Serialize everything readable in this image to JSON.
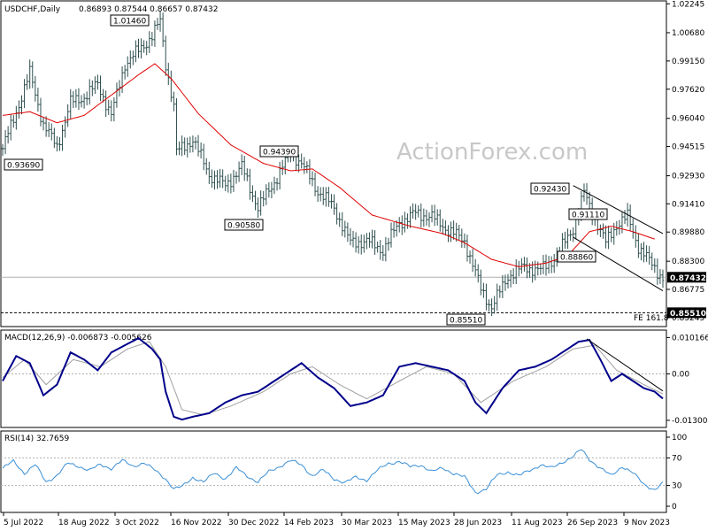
{
  "header": {
    "symbol": "USDCHF,Daily",
    "ohlc": "0.86893 0.87544 0.86657 0.87432"
  },
  "watermark": "ActionForex.com",
  "colors": {
    "bars": "#2f4f4f",
    "ma": "#e00000",
    "macd": "#00008b",
    "signal": "#a0a0a0",
    "rsi": "#3a8fd6",
    "trendline": "#000000"
  },
  "chart_data": [
    {
      "type": "line",
      "title": "USDCHF,Daily",
      "price_axis_labels": [
        "1.02245",
        "1.00680",
        "0.99150",
        "0.97620",
        "0.96040",
        "0.94515",
        "0.92930",
        "0.91410",
        "0.89880",
        "0.88300",
        "0.86775",
        "0.85245"
      ],
      "ylim": [
        0.85,
        1.0226
      ],
      "current_price_label": "0.87432",
      "support_label": "0.85510",
      "fe_label": "FE 161.8",
      "swing_labels": [
        {
          "text": "1.01460",
          "value": 1.0146
        },
        {
          "text": "0.93690",
          "value": 0.9369
        },
        {
          "text": "0.94390",
          "value": 0.9439
        },
        {
          "text": "0.90580",
          "value": 0.9058
        },
        {
          "text": "0.92430",
          "value": 0.9243
        },
        {
          "text": "0.91110",
          "value": 0.9111
        },
        {
          "text": "0.88860",
          "value": 0.8886
        },
        {
          "text": "0.85510",
          "value": 0.8551
        }
      ],
      "date_labels": [
        "5 Jul 2022",
        "18 Aug 2022",
        "3 Oct 2022",
        "16 Nov 2022",
        "30 Dec 2022",
        "14 Feb 2023",
        "30 Mar 2023",
        "15 May 2023",
        "28 Jun 2023",
        "11 Aug 2023",
        "26 Sep 2023",
        "9 Nov 2023"
      ],
      "close_path": [
        [
          0,
          0.944
        ],
        [
          6,
          0.968
        ],
        [
          10,
          0.985
        ],
        [
          15,
          0.957
        ],
        [
          20,
          0.945
        ],
        [
          25,
          0.969
        ],
        [
          30,
          0.972
        ],
        [
          35,
          0.979
        ],
        [
          40,
          0.962
        ],
        [
          45,
          0.99
        ],
        [
          50,
          0.997
        ],
        [
          55,
          1.005
        ],
        [
          58,
          1.013
        ],
        [
          60,
          0.99
        ],
        [
          63,
          0.967
        ],
        [
          64,
          0.942
        ],
        [
          70,
          0.949
        ],
        [
          76,
          0.93
        ],
        [
          82,
          0.924
        ],
        [
          88,
          0.934
        ],
        [
          94,
          0.912
        ],
        [
          100,
          0.926
        ],
        [
          106,
          0.942
        ],
        [
          110,
          0.936
        ],
        [
          116,
          0.921
        ],
        [
          122,
          0.912
        ],
        [
          128,
          0.893
        ],
        [
          134,
          0.894
        ],
        [
          140,
          0.889
        ],
        [
          146,
          0.904
        ],
        [
          152,
          0.909
        ],
        [
          158,
          0.907
        ],
        [
          164,
          0.9
        ],
        [
          170,
          0.894
        ],
        [
          176,
          0.868
        ],
        [
          180,
          0.858
        ],
        [
          186,
          0.875
        ],
        [
          192,
          0.88
        ],
        [
          198,
          0.878
        ],
        [
          204,
          0.886
        ],
        [
          210,
          0.901
        ],
        [
          214,
          0.92
        ],
        [
          218,
          0.906
        ],
        [
          222,
          0.893
        ],
        [
          226,
          0.903
        ],
        [
          230,
          0.907
        ],
        [
          234,
          0.891
        ],
        [
          238,
          0.883
        ],
        [
          243,
          0.874
        ]
      ],
      "ma_path": [
        [
          0,
          0.962
        ],
        [
          10,
          0.964
        ],
        [
          20,
          0.958
        ],
        [
          30,
          0.962
        ],
        [
          40,
          0.973
        ],
        [
          50,
          0.984
        ],
        [
          56,
          0.99
        ],
        [
          62,
          0.982
        ],
        [
          72,
          0.963
        ],
        [
          84,
          0.946
        ],
        [
          96,
          0.936
        ],
        [
          106,
          0.932
        ],
        [
          114,
          0.933
        ],
        [
          124,
          0.923
        ],
        [
          136,
          0.908
        ],
        [
          150,
          0.902
        ],
        [
          162,
          0.898
        ],
        [
          170,
          0.893
        ],
        [
          180,
          0.884
        ],
        [
          190,
          0.88
        ],
        [
          200,
          0.882
        ],
        [
          208,
          0.886
        ],
        [
          216,
          0.899
        ],
        [
          224,
          0.902
        ],
        [
          232,
          0.899
        ],
        [
          240,
          0.895
        ]
      ],
      "trend_channel": [
        {
          "from": [
            210,
            0.924
          ],
          "to": [
            243,
            0.898
          ]
        },
        {
          "from": [
            210,
            0.896
          ],
          "to": [
            243,
            0.867
          ]
        }
      ]
    },
    {
      "type": "line",
      "title": "MACD(12,26,9) -0.006873 -0.005626",
      "axis_labels": [
        "0.010166",
        "0.00",
        "-0.013006"
      ],
      "ylim": [
        -0.0145,
        0.0115
      ],
      "macd_path": [
        [
          0,
          -0.002
        ],
        [
          5,
          0.005
        ],
        [
          10,
          0.003
        ],
        [
          15,
          -0.006
        ],
        [
          20,
          -0.003
        ],
        [
          25,
          0.006
        ],
        [
          30,
          0.004
        ],
        [
          35,
          0.001
        ],
        [
          40,
          0.006
        ],
        [
          45,
          0.008
        ],
        [
          50,
          0.01
        ],
        [
          55,
          0.007
        ],
        [
          58,
          0.004
        ],
        [
          60,
          -0.005
        ],
        [
          63,
          -0.012
        ],
        [
          66,
          -0.0128
        ],
        [
          70,
          -0.012
        ],
        [
          76,
          -0.011
        ],
        [
          82,
          -0.008
        ],
        [
          88,
          -0.006
        ],
        [
          94,
          -0.005
        ],
        [
          100,
          -0.002
        ],
        [
          106,
          0.001
        ],
        [
          110,
          0.003
        ],
        [
          116,
          -0.001
        ],
        [
          122,
          -0.004
        ],
        [
          128,
          -0.009
        ],
        [
          134,
          -0.008
        ],
        [
          140,
          -0.006
        ],
        [
          146,
          0.002
        ],
        [
          152,
          0.003
        ],
        [
          158,
          0.002
        ],
        [
          164,
          0.001
        ],
        [
          170,
          -0.002
        ],
        [
          174,
          -0.008
        ],
        [
          178,
          -0.011
        ],
        [
          184,
          -0.004
        ],
        [
          190,
          0.001
        ],
        [
          196,
          0.002
        ],
        [
          202,
          0.004
        ],
        [
          208,
          0.007
        ],
        [
          212,
          0.009
        ],
        [
          216,
          0.0095
        ],
        [
          220,
          0.004
        ],
        [
          224,
          -0.002
        ],
        [
          228,
          0.0
        ],
        [
          232,
          -0.002
        ],
        [
          236,
          -0.004
        ],
        [
          240,
          -0.005
        ],
        [
          243,
          -0.0069
        ]
      ],
      "signal_path": [
        [
          0,
          -0.001
        ],
        [
          8,
          0.004
        ],
        [
          16,
          -0.003
        ],
        [
          26,
          0.004
        ],
        [
          36,
          0.002
        ],
        [
          46,
          0.007
        ],
        [
          54,
          0.009
        ],
        [
          60,
          0.002
        ],
        [
          66,
          -0.01
        ],
        [
          74,
          -0.0115
        ],
        [
          84,
          -0.009
        ],
        [
          96,
          -0.005
        ],
        [
          106,
          0.0
        ],
        [
          114,
          0.002
        ],
        [
          124,
          -0.003
        ],
        [
          134,
          -0.007
        ],
        [
          146,
          -0.002
        ],
        [
          156,
          0.002
        ],
        [
          166,
          0.0
        ],
        [
          176,
          -0.008
        ],
        [
          188,
          -0.002
        ],
        [
          200,
          0.002
        ],
        [
          210,
          0.007
        ],
        [
          218,
          0.008
        ],
        [
          226,
          0.001
        ],
        [
          236,
          -0.003
        ],
        [
          243,
          -0.0056
        ]
      ],
      "trendline": {
        "from": [
          215,
          0.0098
        ],
        "to": [
          243,
          -0.0048
        ]
      }
    },
    {
      "type": "line",
      "title": "RSI(14) 32.7659",
      "axis_labels": [
        "100",
        "70",
        "30",
        "0"
      ],
      "ylim": [
        0,
        100
      ],
      "levels": [
        70,
        30
      ],
      "rsi_path": [
        [
          0,
          55
        ],
        [
          4,
          65
        ],
        [
          8,
          48
        ],
        [
          12,
          60
        ],
        [
          16,
          35
        ],
        [
          20,
          45
        ],
        [
          24,
          62
        ],
        [
          28,
          58
        ],
        [
          32,
          52
        ],
        [
          36,
          60
        ],
        [
          40,
          55
        ],
        [
          44,
          66
        ],
        [
          48,
          58
        ],
        [
          52,
          63
        ],
        [
          56,
          52
        ],
        [
          60,
          40
        ],
        [
          63,
          25
        ],
        [
          66,
          28
        ],
        [
          70,
          42
        ],
        [
          74,
          35
        ],
        [
          78,
          48
        ],
        [
          82,
          40
        ],
        [
          86,
          55
        ],
        [
          90,
          44
        ],
        [
          94,
          35
        ],
        [
          98,
          50
        ],
        [
          102,
          58
        ],
        [
          106,
          66
        ],
        [
          110,
          60
        ],
        [
          114,
          44
        ],
        [
          118,
          52
        ],
        [
          122,
          40
        ],
        [
          126,
          34
        ],
        [
          130,
          42
        ],
        [
          134,
          38
        ],
        [
          138,
          52
        ],
        [
          142,
          62
        ],
        [
          146,
          65
        ],
        [
          150,
          57
        ],
        [
          154,
          60
        ],
        [
          158,
          50
        ],
        [
          162,
          55
        ],
        [
          166,
          48
        ],
        [
          170,
          42
        ],
        [
          174,
          20
        ],
        [
          178,
          25
        ],
        [
          182,
          45
        ],
        [
          186,
          50
        ],
        [
          190,
          44
        ],
        [
          194,
          52
        ],
        [
          198,
          60
        ],
        [
          202,
          55
        ],
        [
          206,
          64
        ],
        [
          210,
          72
        ],
        [
          213,
          82
        ],
        [
          216,
          68
        ],
        [
          220,
          55
        ],
        [
          224,
          44
        ],
        [
          228,
          58
        ],
        [
          232,
          48
        ],
        [
          236,
          32
        ],
        [
          240,
          24
        ],
        [
          243,
          32.8
        ]
      ]
    }
  ]
}
